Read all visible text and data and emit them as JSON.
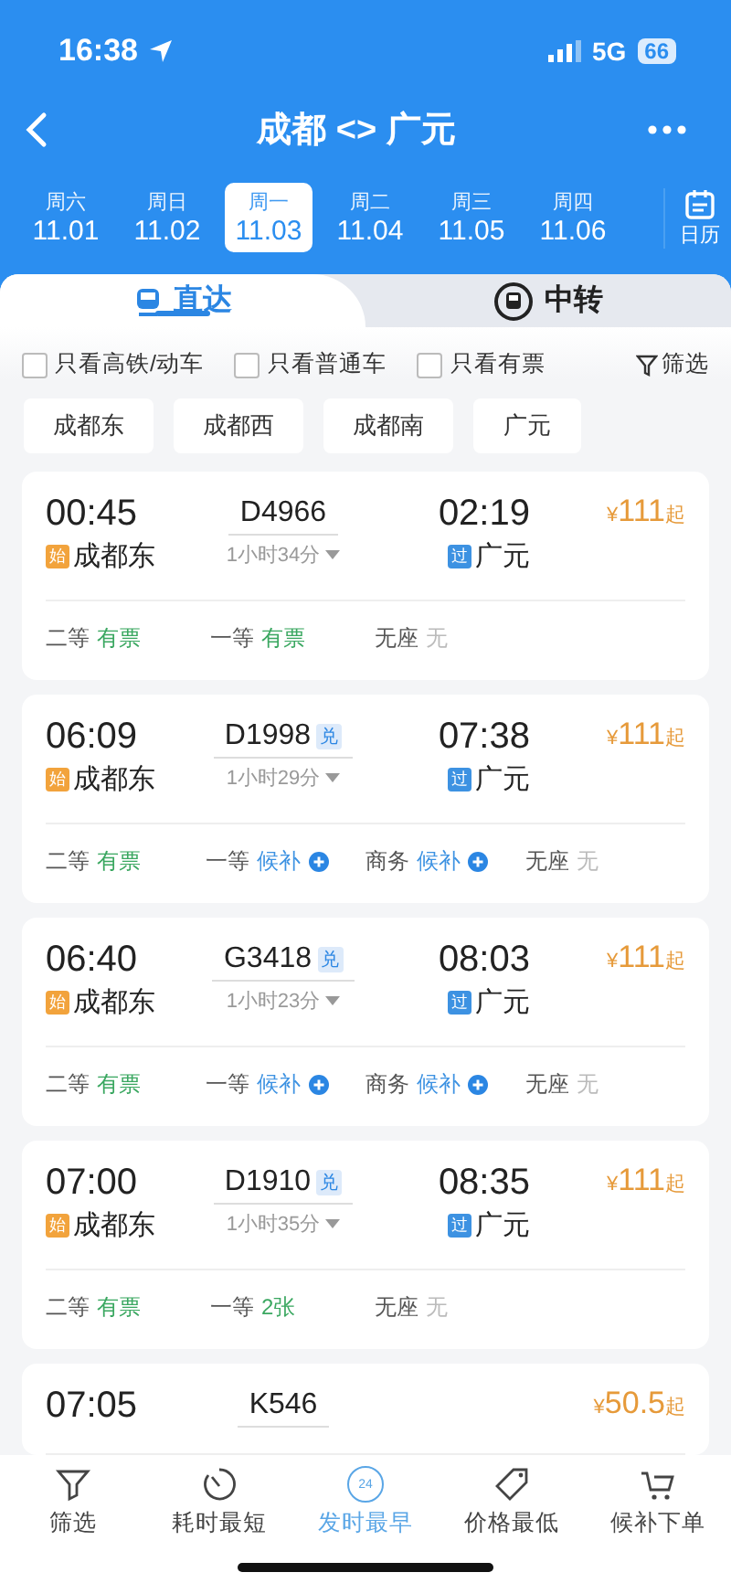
{
  "status_bar": {
    "time": "16:38",
    "network": "5G",
    "battery": "66"
  },
  "header": {
    "title": "成都 <> 广元"
  },
  "dates": [
    {
      "weekday": "周六",
      "date": "11.01",
      "selected": false
    },
    {
      "weekday": "周日",
      "date": "11.02",
      "selected": false
    },
    {
      "weekday": "周一",
      "date": "11.03",
      "selected": true
    },
    {
      "weekday": "周二",
      "date": "11.04",
      "selected": false
    },
    {
      "weekday": "周三",
      "date": "11.05",
      "selected": false
    },
    {
      "weekday": "周四",
      "date": "11.06",
      "selected": false
    }
  ],
  "calendar_label": "日历",
  "tabs": [
    {
      "label": "直达",
      "selected": true
    },
    {
      "label": "中转",
      "selected": false
    }
  ],
  "filters": [
    {
      "label": "只看高铁/动车",
      "checked": false
    },
    {
      "label": "只看普通车",
      "checked": false
    },
    {
      "label": "只看有票",
      "checked": false
    }
  ],
  "filter_button": "筛选",
  "stations": [
    "成都东",
    "成都西",
    "成都南",
    "广元"
  ],
  "trains": [
    {
      "depart": "00:45",
      "from_tag": "始",
      "from": "成都东",
      "number": "D4966",
      "exchange": false,
      "duration": "1小时34分",
      "arrive": "02:19",
      "to_tag": "过",
      "to": "广元",
      "currency": "¥",
      "price": "111",
      "price_suffix": "起",
      "seats": [
        {
          "class": "二等",
          "status": "有票",
          "kind": "available"
        },
        {
          "class": "一等",
          "status": "有票",
          "kind": "available"
        },
        {
          "class": "无座",
          "status": "无",
          "kind": "none"
        }
      ]
    },
    {
      "depart": "06:09",
      "from_tag": "始",
      "from": "成都东",
      "number": "D1998",
      "exchange": true,
      "exchange_label": "兑",
      "duration": "1小时29分",
      "arrive": "07:38",
      "to_tag": "过",
      "to": "广元",
      "currency": "¥",
      "price": "111",
      "price_suffix": "起",
      "seats": [
        {
          "class": "二等",
          "status": "有票",
          "kind": "available"
        },
        {
          "class": "一等",
          "status": "候补",
          "kind": "waitlist"
        },
        {
          "class": "商务",
          "status": "候补",
          "kind": "waitlist"
        },
        {
          "class": "无座",
          "status": "无",
          "kind": "none"
        }
      ]
    },
    {
      "depart": "06:40",
      "from_tag": "始",
      "from": "成都东",
      "number": "G3418",
      "exchange": true,
      "exchange_label": "兑",
      "duration": "1小时23分",
      "arrive": "08:03",
      "to_tag": "过",
      "to": "广元",
      "currency": "¥",
      "price": "111",
      "price_suffix": "起",
      "seats": [
        {
          "class": "二等",
          "status": "有票",
          "kind": "available"
        },
        {
          "class": "一等",
          "status": "候补",
          "kind": "waitlist"
        },
        {
          "class": "商务",
          "status": "候补",
          "kind": "waitlist"
        },
        {
          "class": "无座",
          "status": "无",
          "kind": "none"
        }
      ]
    },
    {
      "depart": "07:00",
      "from_tag": "始",
      "from": "成都东",
      "number": "D1910",
      "exchange": true,
      "exchange_label": "兑",
      "duration": "1小时35分",
      "arrive": "08:35",
      "to_tag": "过",
      "to": "广元",
      "currency": "¥",
      "price": "111",
      "price_suffix": "起",
      "seats": [
        {
          "class": "二等",
          "status": "有票",
          "kind": "available"
        },
        {
          "class": "一等",
          "status": "2张",
          "kind": "available"
        },
        {
          "class": "无座",
          "status": "无",
          "kind": "none"
        }
      ]
    },
    {
      "depart": "07:05",
      "number": "K546",
      "exchange": false,
      "currency": "¥",
      "price": "50.5",
      "price_suffix": "起"
    }
  ],
  "bottom_nav": [
    {
      "label": "筛选",
      "selected": false
    },
    {
      "label": "耗时最短",
      "selected": false
    },
    {
      "label": "发时最早",
      "icon_text": "24",
      "selected": true
    },
    {
      "label": "价格最低",
      "selected": false
    },
    {
      "label": "候补下单",
      "selected": false
    }
  ]
}
